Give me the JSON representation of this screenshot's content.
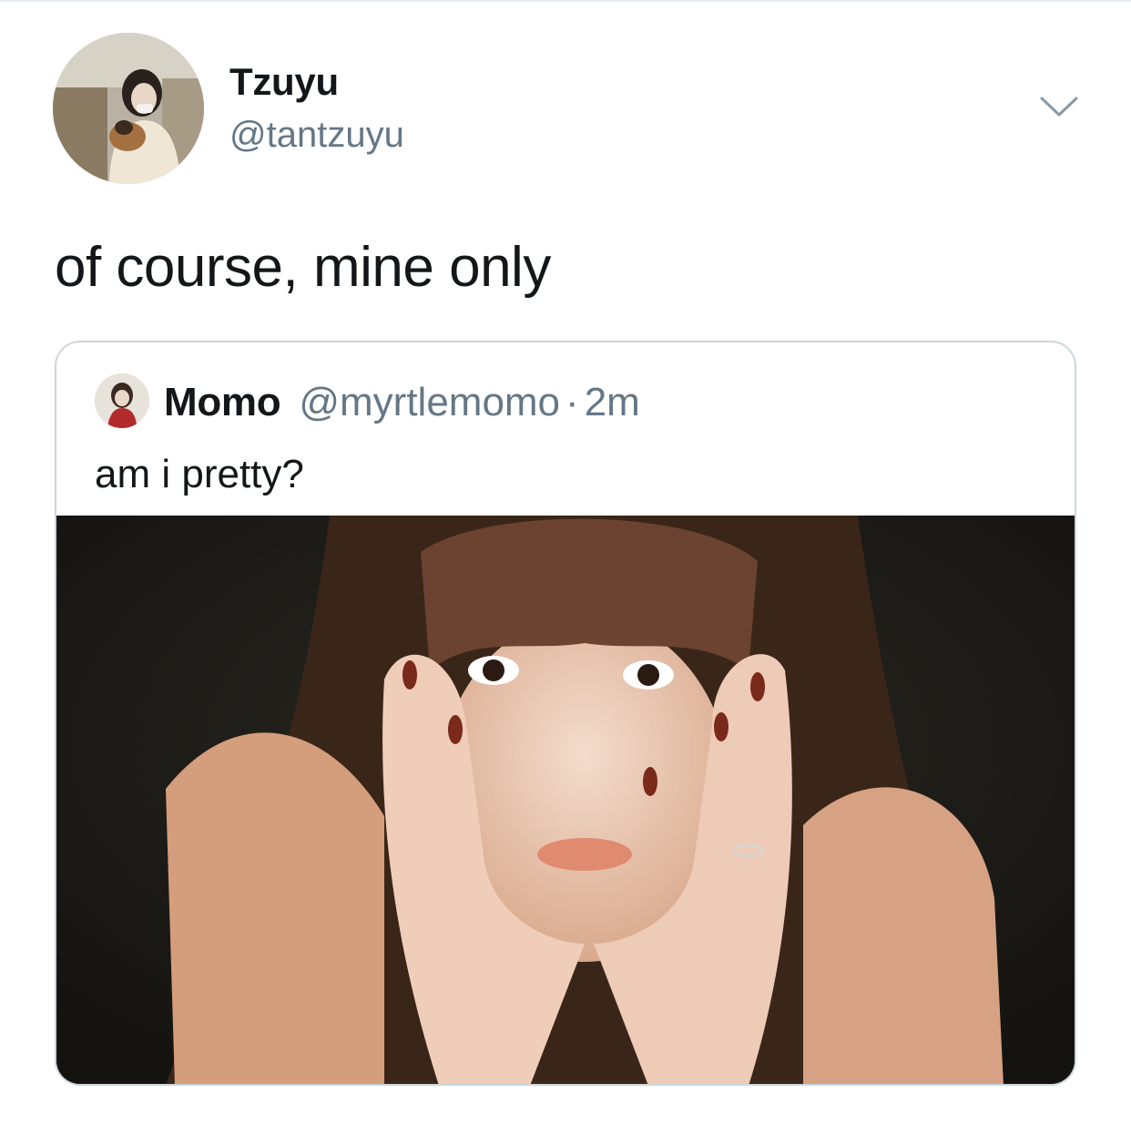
{
  "tweet": {
    "author": {
      "display_name": "Tzuyu",
      "handle": "@tantzuyu"
    },
    "text": "of course, mine only",
    "menu_icon": "chevron-down-icon"
  },
  "quoted_tweet": {
    "author": {
      "display_name": "Momo",
      "handle": "@myrtlemomo"
    },
    "separator": "·",
    "time": "2m",
    "text": "am i pretty?"
  },
  "colors": {
    "primary_text": "#14171a",
    "secondary_text": "#657786",
    "border": "#ccd6dd"
  }
}
